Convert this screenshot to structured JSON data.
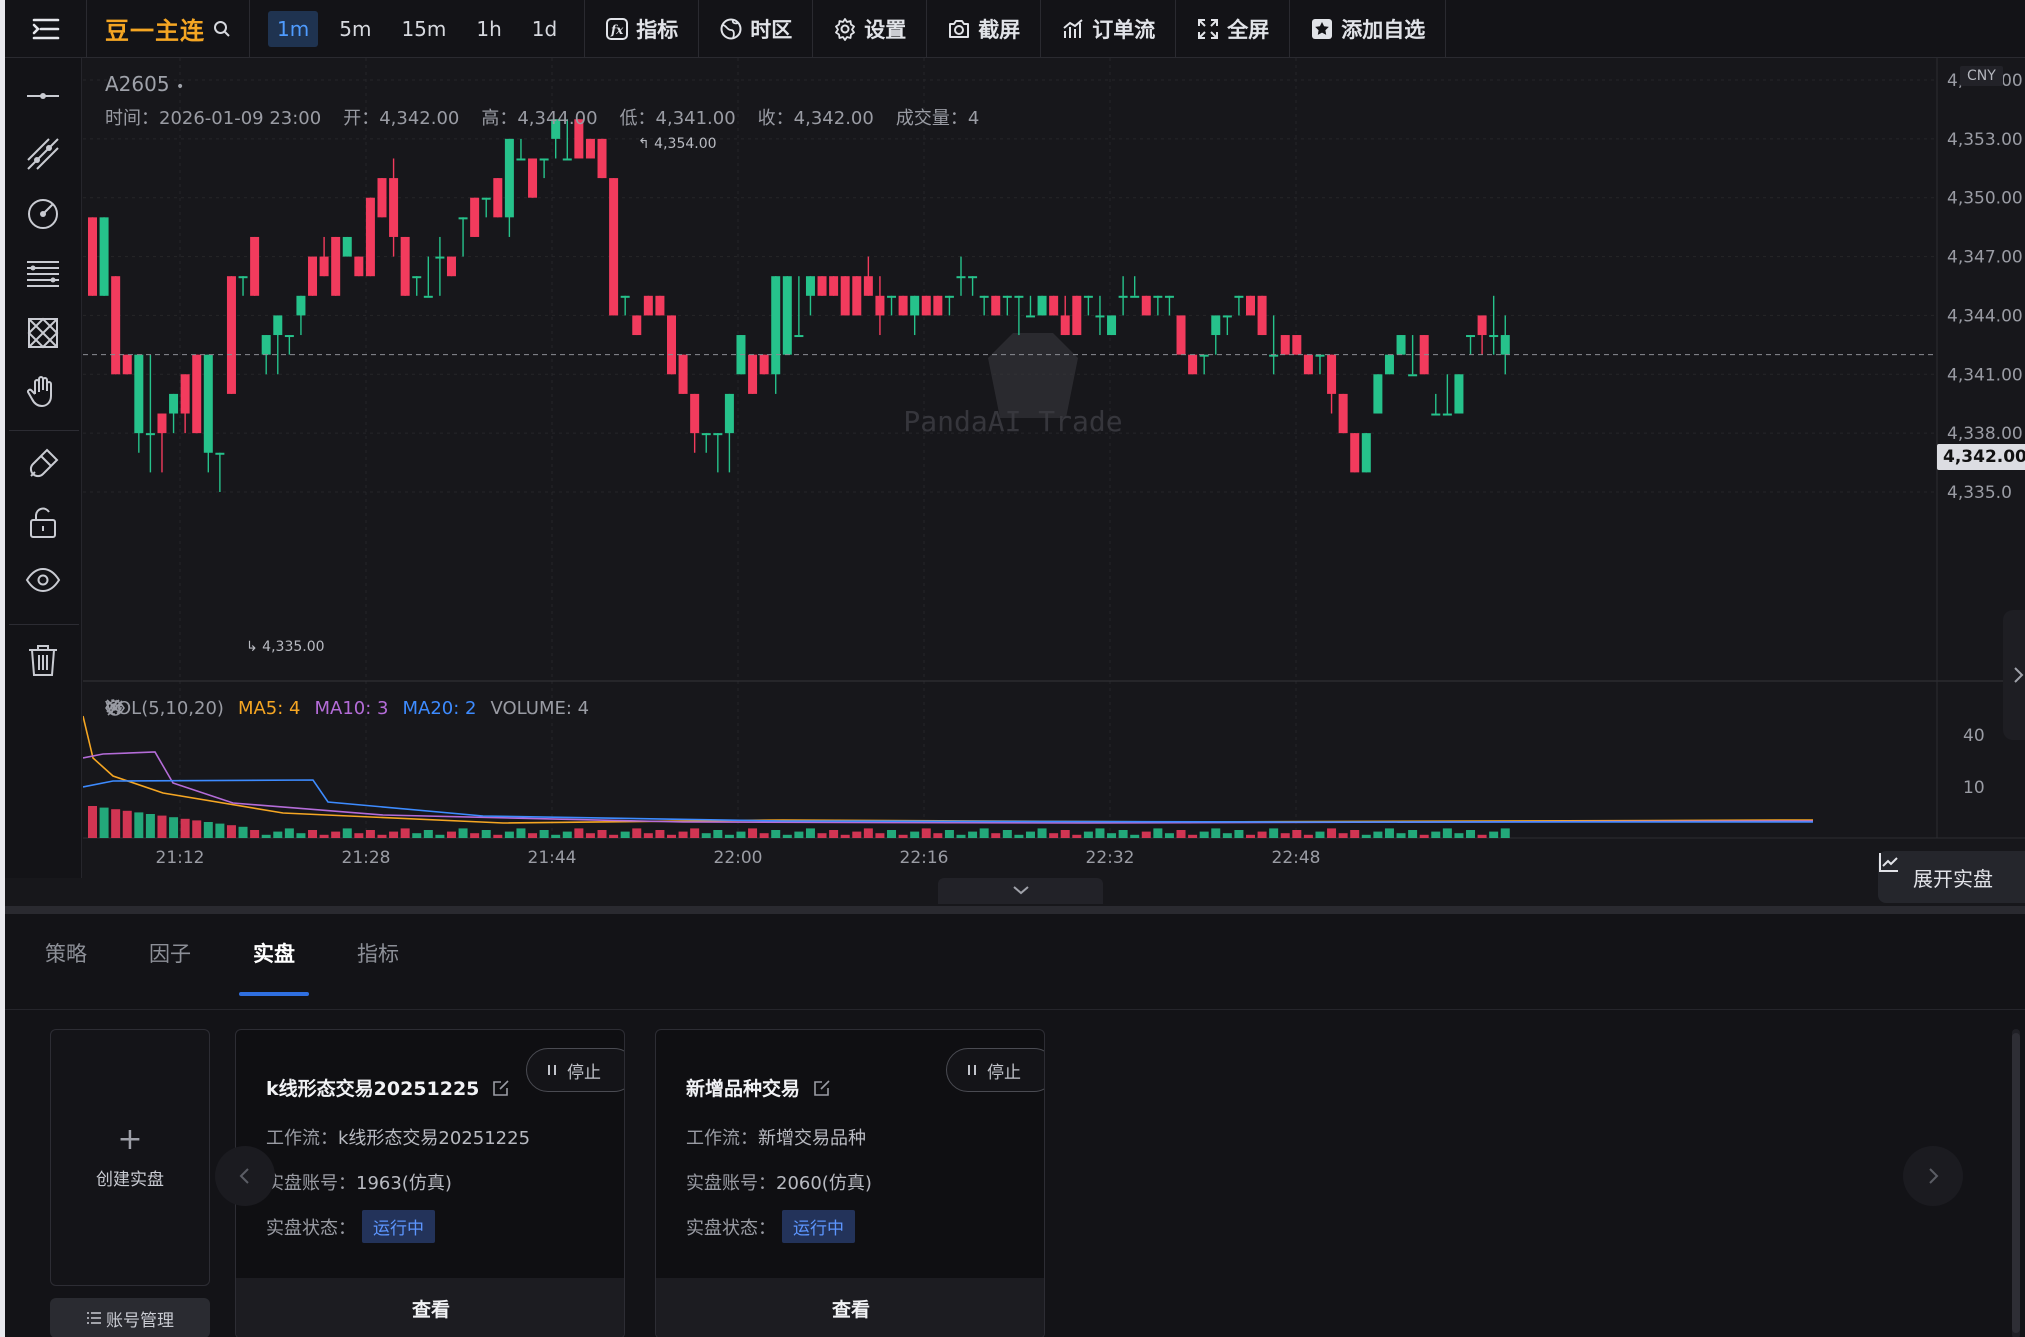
{
  "toolbar": {
    "symbol": "豆一主连",
    "timeframes": [
      "1m",
      "5m",
      "15m",
      "1h",
      "1d"
    ],
    "active_timeframe": "1m",
    "buttons": [
      "指标",
      "时区",
      "设置",
      "截屏",
      "订单流",
      "全屏",
      "添加自选"
    ]
  },
  "chart_header": {
    "contract": "A2605",
    "ohlc": [
      {
        "label": "时间：",
        "value": "2026-01-09 23:00"
      },
      {
        "label": "开：",
        "value": "4,342.00"
      },
      {
        "label": "高：",
        "value": "4,344.00"
      },
      {
        "label": "低：",
        "value": "4,341.00"
      },
      {
        "label": "收：",
        "value": "4,342.00"
      },
      {
        "label": "成交量：",
        "value": "4"
      }
    ],
    "currency": "CNY",
    "last_price": "4,342.00",
    "high_marker": "4,354.00",
    "low_marker": "4,335.00",
    "watermark": "PandaAI Trade"
  },
  "volume_legend": {
    "name": "VOL(5,10,20)",
    "ma5": "MA5: 4",
    "ma10": "MA10: 3",
    "ma20": "MA20: 2",
    "volume": "VOLUME: 4"
  },
  "expand_live_label": "展开实盘",
  "chart_data": {
    "type": "candlestick",
    "y_ticks": [
      "4,356.00",
      "4,353.00",
      "4,350.00",
      "4,347.00",
      "4,344.00",
      "4,341.00",
      "4,338.00",
      "4,335.0"
    ],
    "volume_ticks": [
      "40",
      "10"
    ],
    "x_ticks": [
      "21:12",
      "21:28",
      "21:44",
      "22:00",
      "22:16",
      "22:32",
      "22:48"
    ],
    "ylim": [
      4333,
      4357
    ],
    "up_color": "#26c28b",
    "down_color": "#f23b5d",
    "candles": [
      [
        4349,
        4349,
        4345,
        4345
      ],
      [
        4345,
        4349,
        4345,
        4349
      ],
      [
        4346,
        4346,
        4341,
        4341
      ],
      [
        4342,
        4342,
        4341,
        4341
      ],
      [
        4338,
        4342,
        4337,
        4342
      ],
      [
        4338,
        4342,
        4336,
        4338
      ],
      [
        4339,
        4339,
        4336,
        4338
      ],
      [
        4339,
        4340,
        4338,
        4340
      ],
      [
        4341,
        4341,
        4338,
        4339
      ],
      [
        4342,
        4342,
        4338,
        4338
      ],
      [
        4337,
        4342,
        4336,
        4342
      ],
      [
        4337,
        4337,
        4335,
        4337
      ],
      [
        4346,
        4346,
        4340,
        4340
      ],
      [
        4346,
        4346,
        4345,
        4346
      ],
      [
        4348,
        4348,
        4345,
        4345
      ],
      [
        4342,
        4343,
        4341,
        4343
      ],
      [
        4343,
        4344,
        4341,
        4344
      ],
      [
        4343,
        4343,
        4342,
        4343
      ],
      [
        4344,
        4345,
        4343,
        4345
      ],
      [
        4347,
        4347,
        4345,
        4345
      ],
      [
        4347,
        4348,
        4346,
        4346
      ],
      [
        4348,
        4348,
        4345,
        4345
      ],
      [
        4347,
        4348,
        4347,
        4348
      ],
      [
        4347,
        4347,
        4346,
        4346
      ],
      [
        4350,
        4350,
        4346,
        4346
      ],
      [
        4351,
        4351,
        4349,
        4349
      ],
      [
        4351,
        4352,
        4347,
        4348
      ],
      [
        4348,
        4348,
        4345,
        4345
      ],
      [
        4346,
        4346,
        4345,
        4346
      ],
      [
        4345,
        4347,
        4345,
        4345
      ],
      [
        4347,
        4348,
        4345,
        4347
      ],
      [
        4347,
        4347,
        4346,
        4346
      ],
      [
        4349,
        4349,
        4347,
        4349
      ],
      [
        4350,
        4350,
        4348,
        4348
      ],
      [
        4350,
        4350,
        4349,
        4350
      ],
      [
        4351,
        4351,
        4349,
        4349
      ],
      [
        4349,
        4353,
        4348,
        4353
      ],
      [
        4352,
        4353,
        4352,
        4352
      ],
      [
        4352,
        4352,
        4350,
        4350
      ],
      [
        4352,
        4352,
        4351,
        4352
      ],
      [
        4353,
        4354,
        4352,
        4354
      ],
      [
        4352,
        4354,
        4352,
        4352
      ],
      [
        4354,
        4354,
        4352,
        4352
      ],
      [
        4353,
        4353,
        4352,
        4352
      ],
      [
        4353,
        4353,
        4351,
        4351
      ],
      [
        4351,
        4351,
        4344,
        4344
      ],
      [
        4345,
        4345,
        4344,
        4345
      ],
      [
        4344,
        4344,
        4343,
        4343
      ],
      [
        4345,
        4345,
        4344,
        4344
      ],
      [
        4345,
        4345,
        4344,
        4344
      ],
      [
        4344,
        4344,
        4341,
        4341
      ],
      [
        4342,
        4342,
        4340,
        4340
      ],
      [
        4340,
        4340,
        4337,
        4338
      ],
      [
        4338,
        4338,
        4337,
        4338
      ],
      [
        4338,
        4338,
        4336,
        4338
      ],
      [
        4338,
        4340,
        4336,
        4340
      ],
      [
        4341,
        4343,
        4341,
        4343
      ],
      [
        4342,
        4342,
        4340,
        4340
      ],
      [
        4342,
        4342,
        4341,
        4341
      ],
      [
        4341,
        4346,
        4340,
        4346
      ],
      [
        4342,
        4346,
        4342,
        4346
      ],
      [
        4343,
        4346,
        4343,
        4343
      ],
      [
        4345,
        4346,
        4344,
        4346
      ],
      [
        4346,
        4346,
        4345,
        4345
      ],
      [
        4346,
        4346,
        4345,
        4345
      ],
      [
        4346,
        4346,
        4344,
        4344
      ],
      [
        4346,
        4346,
        4344,
        4344
      ],
      [
        4346,
        4347,
        4345,
        4345
      ],
      [
        4345,
        4346,
        4343,
        4344
      ],
      [
        4345,
        4345,
        4344,
        4345
      ],
      [
        4345,
        4345,
        4344,
        4344
      ],
      [
        4344,
        4345,
        4343,
        4345
      ],
      [
        4345,
        4345,
        4344,
        4344
      ],
      [
        4345,
        4345,
        4344,
        4344
      ],
      [
        4345,
        4345,
        4344,
        4345
      ],
      [
        4346,
        4347,
        4345,
        4346
      ],
      [
        4346,
        4346,
        4345,
        4346
      ],
      [
        4345,
        4345,
        4344,
        4345
      ],
      [
        4345,
        4345,
        4344,
        4344
      ],
      [
        4345,
        4345,
        4344,
        4345
      ],
      [
        4345,
        4345,
        4343,
        4345
      ],
      [
        4344,
        4345,
        4344,
        4344
      ],
      [
        4344,
        4345,
        4344,
        4345
      ],
      [
        4345,
        4345,
        4344,
        4344
      ],
      [
        4344,
        4345,
        4343,
        4343
      ],
      [
        4345,
        4345,
        4343,
        4343
      ],
      [
        4345,
        4345,
        4344,
        4345
      ],
      [
        4344,
        4345,
        4343,
        4344
      ],
      [
        4343,
        4344,
        4343,
        4344
      ],
      [
        4345,
        4346,
        4344,
        4345
      ],
      [
        4345,
        4346,
        4345,
        4345
      ],
      [
        4345,
        4345,
        4344,
        4344
      ],
      [
        4345,
        4345,
        4344,
        4345
      ],
      [
        4345,
        4345,
        4344,
        4345
      ],
      [
        4344,
        4344,
        4342,
        4342
      ],
      [
        4342,
        4342,
        4341,
        4341
      ],
      [
        4342,
        4342,
        4341,
        4342
      ],
      [
        4343,
        4344,
        4342,
        4344
      ],
      [
        4344,
        4344,
        4343,
        4344
      ],
      [
        4345,
        4345,
        4344,
        4345
      ],
      [
        4345,
        4345,
        4344,
        4344
      ],
      [
        4345,
        4345,
        4343,
        4343
      ],
      [
        4342,
        4344,
        4341,
        4342
      ],
      [
        4343,
        4343,
        4342,
        4342
      ],
      [
        4343,
        4343,
        4342,
        4342
      ],
      [
        4342,
        4342,
        4341,
        4341
      ],
      [
        4342,
        4342,
        4341,
        4342
      ],
      [
        4342,
        4342,
        4339,
        4340
      ],
      [
        4340,
        4340,
        4338,
        4338
      ],
      [
        4338,
        4338,
        4336,
        4336
      ],
      [
        4336,
        4338,
        4336,
        4338
      ],
      [
        4339,
        4341,
        4339,
        4341
      ],
      [
        4341,
        4342,
        4341,
        4342
      ],
      [
        4342,
        4343,
        4342,
        4343
      ],
      [
        4341,
        4343,
        4341,
        4341
      ],
      [
        4343,
        4343,
        4341,
        4341
      ],
      [
        4339,
        4340,
        4339,
        4339
      ],
      [
        4339,
        4341,
        4339,
        4339
      ],
      [
        4339,
        4341,
        4339,
        4341
      ],
      [
        4343,
        4343,
        4342,
        4343
      ],
      [
        4344,
        4344,
        4342,
        4343
      ],
      [
        4343,
        4345,
        4342,
        4343
      ],
      [
        4342,
        4344,
        4341,
        4343
      ]
    ]
  },
  "bottom_tabs": [
    "策略",
    "因子",
    "实盘",
    "指标"
  ],
  "active_tab": "实盘",
  "create_card_label": "创建实盘",
  "account_manage_label": "账号管理",
  "live_cards": [
    {
      "name": "k线形态交易20251225",
      "stop_label": "停止",
      "workflow_label": "工作流：",
      "workflow": "k线形态交易20251225",
      "account_label": "实盘账号：",
      "account": "1963(仿真)",
      "status_label": "实盘状态：",
      "status": "运行中",
      "view_label": "查看"
    },
    {
      "name": "新增品种交易",
      "stop_label": "停止",
      "workflow_label": "工作流：",
      "workflow": "新增交易品种",
      "account_label": "实盘账号：",
      "account": "2060(仿真)",
      "status_label": "实盘状态：",
      "status": "运行中",
      "view_label": "查看"
    }
  ]
}
